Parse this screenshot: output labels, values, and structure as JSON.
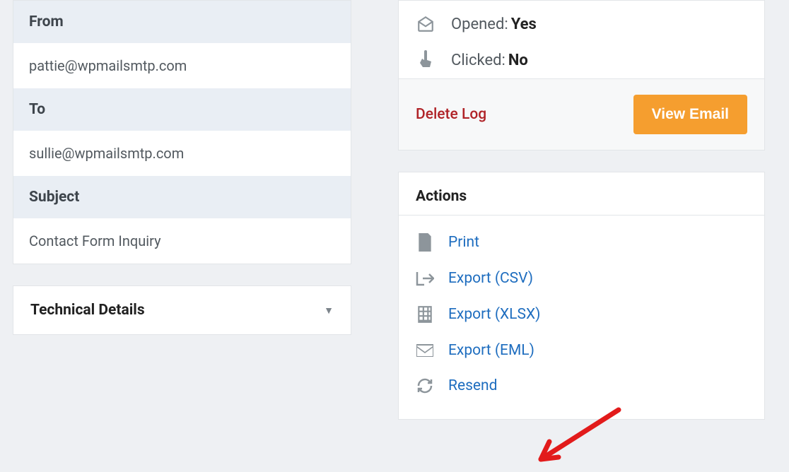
{
  "details": {
    "from_label": "From",
    "from_value": "pattie@wpmailsmtp.com",
    "to_label": "To",
    "to_value": "sullie@wpmailsmtp.com",
    "subject_label": "Subject",
    "subject_value": "Contact Form Inquiry"
  },
  "technical_details_label": "Technical Details",
  "status": {
    "opened_label": "Opened:",
    "opened_value": "Yes",
    "clicked_label": "Clicked:",
    "clicked_value": "No"
  },
  "delete_log_label": "Delete Log",
  "view_email_label": "View Email",
  "actions_title": "Actions",
  "actions": {
    "print": "Print",
    "export_csv": "Export (CSV)",
    "export_xlsx": "Export (XLSX)",
    "export_eml": "Export (EML)",
    "resend": "Resend"
  }
}
